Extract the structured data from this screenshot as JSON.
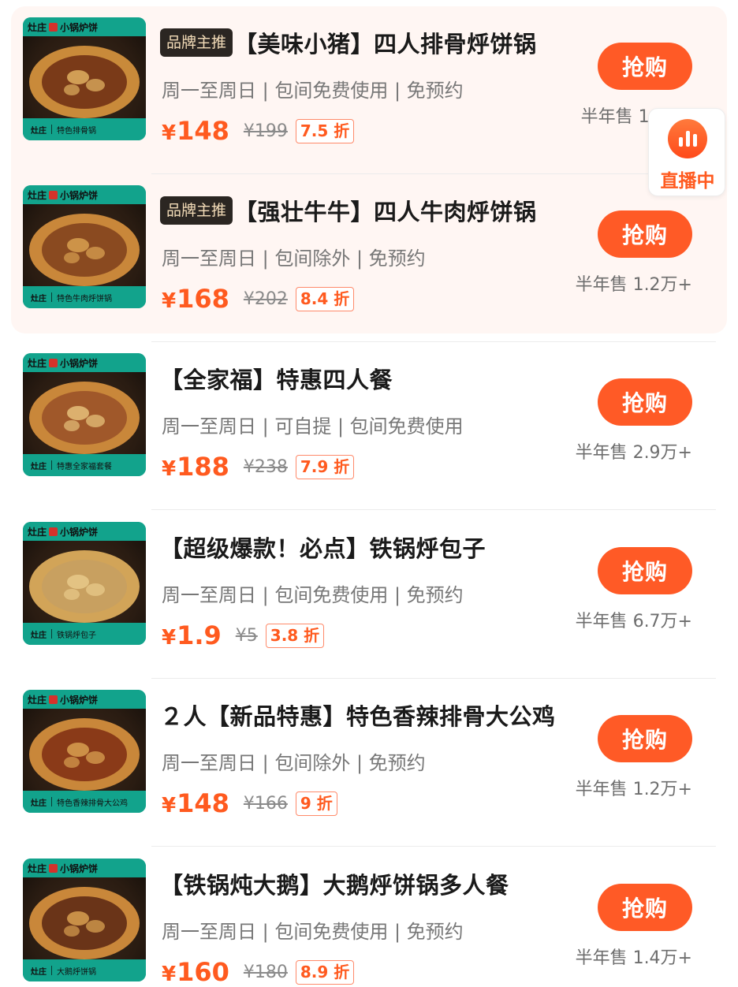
{
  "brand_tag_label": "品牌主推",
  "buy_label": "抢购",
  "live": {
    "label": "直播中",
    "icon": "live-bars-icon"
  },
  "colors": {
    "accent": "#ff5a26",
    "price": "#ff5a1f",
    "thumb_green": "#12a38c",
    "highlight_bg": "#fff6f3"
  },
  "thumb_brand": {
    "logo": "灶庄",
    "name": "小锅炉饼"
  },
  "items": [
    {
      "brand_tag": true,
      "title": "【美味小猪】四人排骨烀饼锅",
      "subtitle": "周一至周日 | 包间免费使用 | 免预约",
      "price": "148",
      "original_price": "¥199",
      "discount": "7.5 折",
      "sales": "半年售 10万+",
      "caption": "特色排骨锅"
    },
    {
      "brand_tag": true,
      "title": "【强壮牛牛】四人牛肉烀饼锅",
      "subtitle": "周一至周日 | 包间除外 | 免预约",
      "price": "168",
      "original_price": "¥202",
      "discount": "8.4 折",
      "sales": "半年售 1.2万+",
      "caption": "特色牛肉烀饼锅"
    },
    {
      "brand_tag": false,
      "title": "【全家福】特惠四人餐",
      "subtitle": "周一至周日 | 可自提 | 包间免费使用",
      "price": "188",
      "original_price": "¥238",
      "discount": "7.9 折",
      "sales": "半年售 2.9万+",
      "caption": "特惠全家福套餐"
    },
    {
      "brand_tag": false,
      "title": "【超级爆款！必点】铁锅烀包子",
      "subtitle": "周一至周日 | 包间免费使用 | 免预约",
      "price": "1.9",
      "original_price": "¥5",
      "discount": "3.8 折",
      "sales": "半年售 6.7万+",
      "caption": "铁锅烀包子"
    },
    {
      "brand_tag": false,
      "title": "２人【新品特惠】特色香辣排骨大公鸡",
      "subtitle": "周一至周日 | 包间除外 | 免预约",
      "price": "148",
      "original_price": "¥166",
      "discount": "9 折",
      "sales": "半年售 1.2万+",
      "caption": "特色香辣排骨大公鸡"
    },
    {
      "brand_tag": false,
      "title": "【铁锅炖大鹅】大鹅烀饼锅多人餐",
      "subtitle": "周一至周日 | 包间免费使用 | 免预约",
      "price": "160",
      "original_price": "¥180",
      "discount": "8.9 折",
      "sales": "半年售 1.4万+",
      "caption": "大鹅烀饼锅"
    }
  ]
}
